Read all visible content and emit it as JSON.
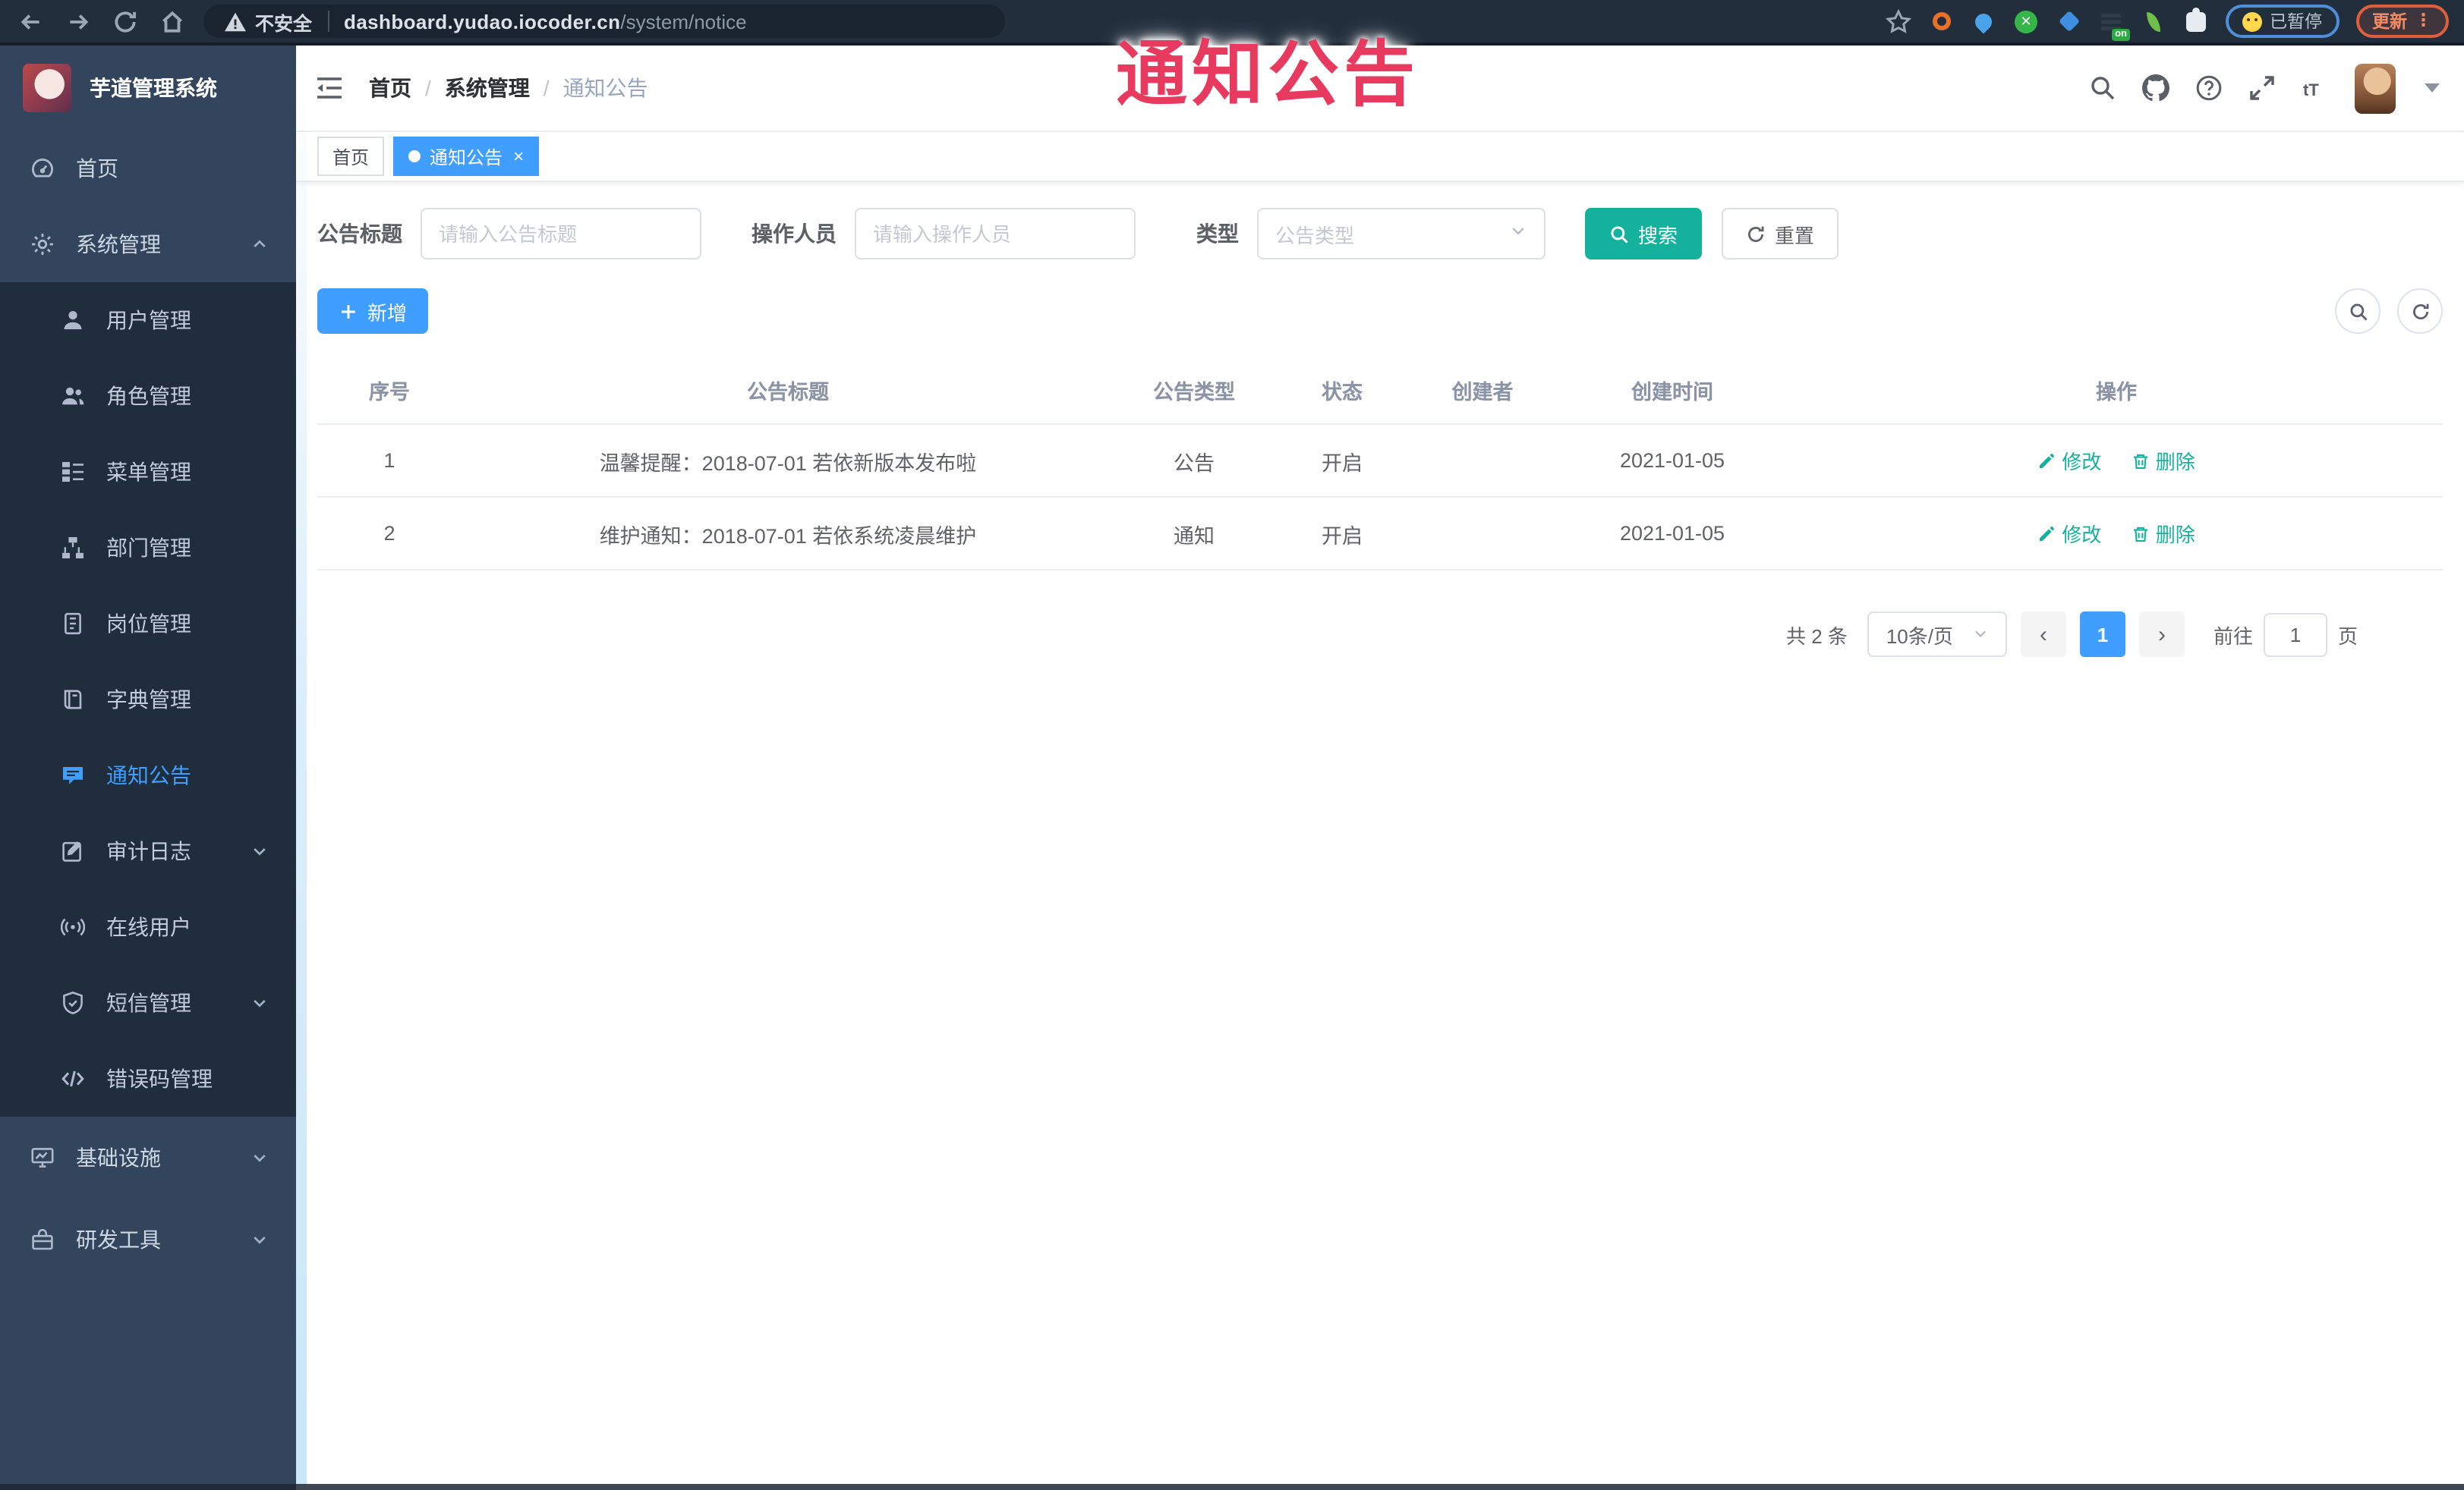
{
  "colors": {
    "primary_blue": "#409EFF",
    "teal": "#14b29c",
    "annotation_red": "#e83a5f",
    "sidebar_bg": "#33455c",
    "submenu_bg": "#1f2d3c"
  },
  "browser": {
    "security_warning": "不安全",
    "url_host": "dashboard.yudao.iocoder.cn",
    "url_path": "/system/notice",
    "extension_on_badge": "on",
    "paused_label": "已暂停",
    "update_label": "更新",
    "kebab": "⋮"
  },
  "annotation": {
    "text": "通知公告"
  },
  "sidebar": {
    "logo_title": "芋道管理系统",
    "home": {
      "label": "首页"
    },
    "system": {
      "label": "系统管理"
    },
    "children": [
      {
        "label": "用户管理"
      },
      {
        "label": "角色管理"
      },
      {
        "label": "菜单管理"
      },
      {
        "label": "部门管理"
      },
      {
        "label": "岗位管理"
      },
      {
        "label": "字典管理"
      },
      {
        "label": "通知公告"
      },
      {
        "label": "审计日志"
      },
      {
        "label": "在线用户"
      },
      {
        "label": "短信管理"
      },
      {
        "label": "错误码管理"
      }
    ],
    "bottom": [
      {
        "label": "基础设施"
      },
      {
        "label": "研发工具"
      }
    ]
  },
  "navbar": {
    "breadcrumb": {
      "item1": "首页",
      "sep": "/",
      "item2": "系统管理",
      "item3": "通知公告"
    }
  },
  "tags": {
    "tag1": "首页",
    "tag2": "通知公告",
    "close": "×"
  },
  "filters": {
    "title_label": "公告标题",
    "title_placeholder": "请输入公告标题",
    "operator_label": "操作人员",
    "operator_placeholder": "请输入操作人员",
    "type_label": "类型",
    "type_placeholder": "公告类型",
    "search_label": "搜索",
    "reset_label": "重置"
  },
  "toolbar": {
    "add_label": "新增"
  },
  "table": {
    "columns": {
      "no": "序号",
      "title": "公告标题",
      "type": "公告类型",
      "status": "状态",
      "creator": "创建者",
      "created": "创建时间",
      "ops": "操作"
    },
    "rows": [
      {
        "no": "1",
        "title": "温馨提醒：2018-07-01 若依新版本发布啦",
        "type": "公告",
        "status": "开启",
        "creator": "",
        "created": "2021-01-05"
      },
      {
        "no": "2",
        "title": "维护通知：2018-07-01 若依系统凌晨维护",
        "type": "通知",
        "status": "开启",
        "creator": "",
        "created": "2021-01-05"
      }
    ],
    "actions": {
      "edit": "修改",
      "delete": "删除"
    }
  },
  "pagination": {
    "total_text": "共 2 条",
    "page_size": "10条/页",
    "prev": "‹",
    "page": "1",
    "next": "›",
    "goto_prefix": "前往",
    "goto_value": "1",
    "goto_suffix": "页"
  }
}
